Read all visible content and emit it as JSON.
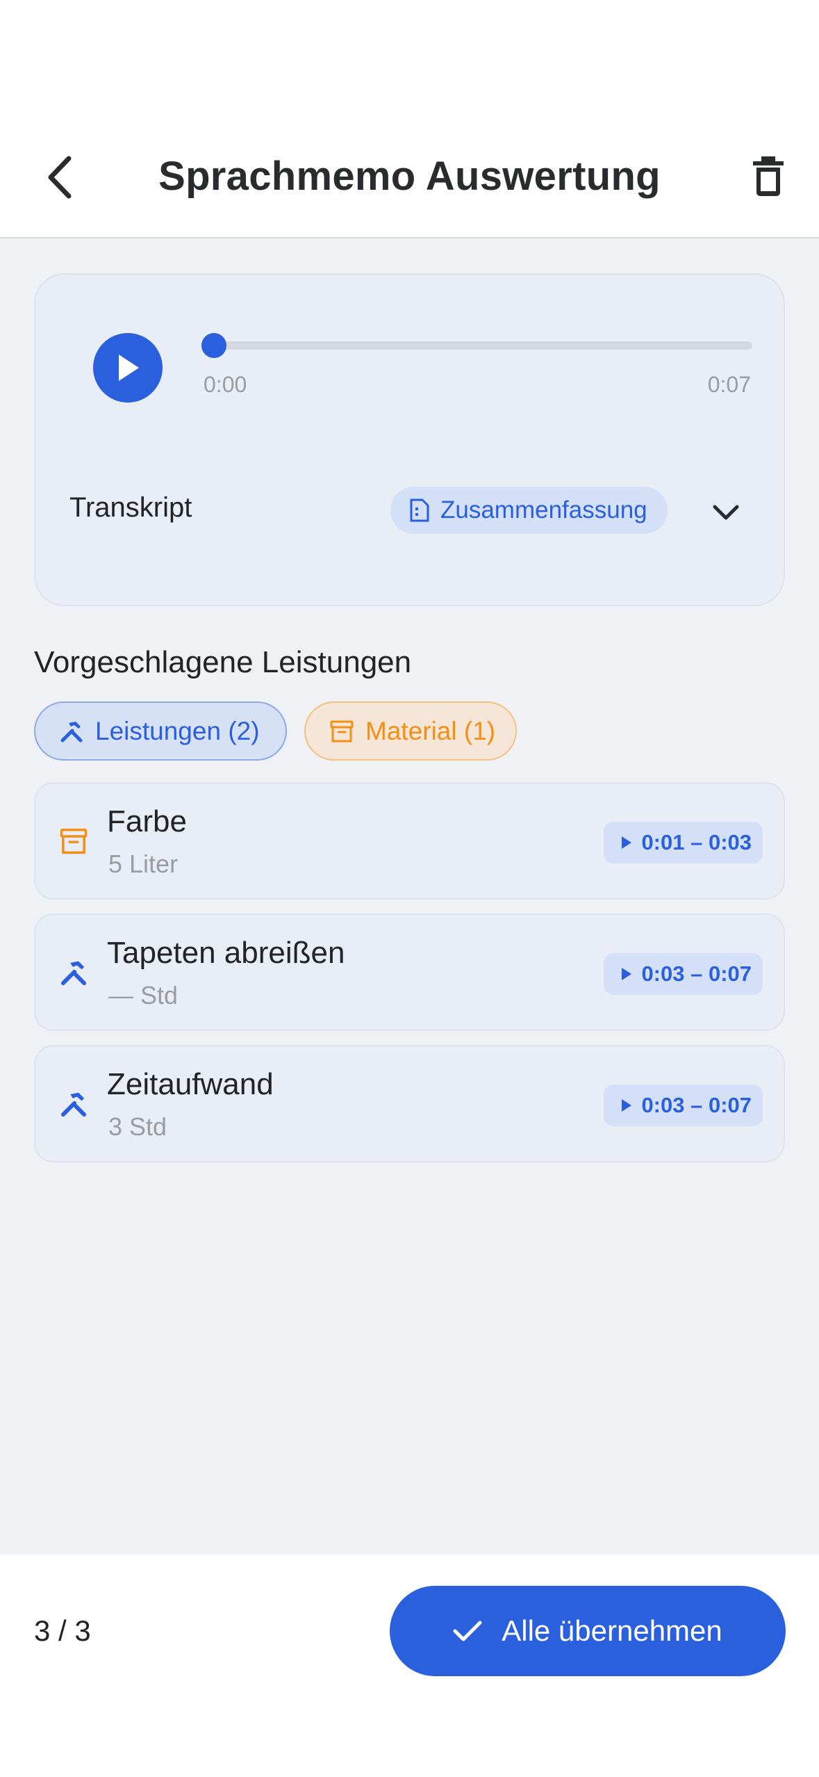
{
  "header": {
    "title": "Sprachmemo Auswertung",
    "back_icon": "chevron-left-icon",
    "delete_icon": "trash-icon"
  },
  "player": {
    "current_time": "0:00",
    "duration": "0:07",
    "progress_fraction": 0,
    "transcript_label": "Transkript",
    "summary_chip_label": "Zusammenfassung"
  },
  "suggestions": {
    "section_title": "Vorgeschlagene Leistungen",
    "filters": [
      {
        "label": "Leistungen (2)",
        "icon": "tools-icon",
        "color": "#2a60dd"
      },
      {
        "label": "Material (1)",
        "icon": "archive-box-icon",
        "color": "#f28f14"
      }
    ],
    "items": [
      {
        "name": "Farbe",
        "detail": "5 Liter",
        "type": "material",
        "segment": "0:01 – 0:03"
      },
      {
        "name": "Tapeten abreißen",
        "detail": "— Std",
        "type": "leistung",
        "segment": "0:03 – 0:07"
      },
      {
        "name": "Zeitaufwand",
        "detail": "3 Std",
        "type": "leistung",
        "segment": "0:03 – 0:07"
      }
    ]
  },
  "footer": {
    "counter": "3 / 3",
    "accept_all_label": "Alle übernehmen"
  },
  "colors": {
    "accent": "#2a60dd",
    "material": "#f28f14",
    "background": "#eff1f5"
  }
}
